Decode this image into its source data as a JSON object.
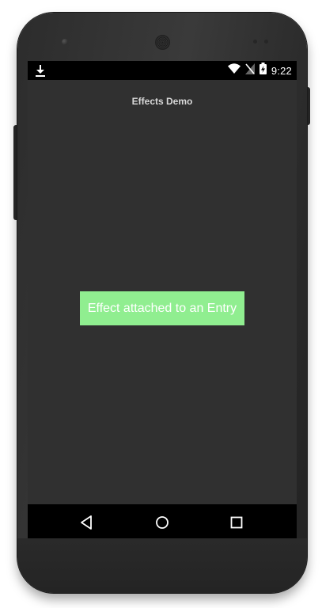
{
  "status_bar": {
    "time": "9:22",
    "icons": [
      "download-icon",
      "wifi-icon",
      "no-sim-icon",
      "battery-charging-icon"
    ]
  },
  "app": {
    "title": "Effects Demo"
  },
  "entry": {
    "value": "Effect attached to an Entry",
    "background_color": "#90ee90",
    "text_color": "#ffffff"
  },
  "navigation": {
    "buttons": [
      "back-icon",
      "home-icon",
      "recents-icon"
    ]
  },
  "colors": {
    "screen_background": "#303030",
    "bars": "#000000"
  }
}
